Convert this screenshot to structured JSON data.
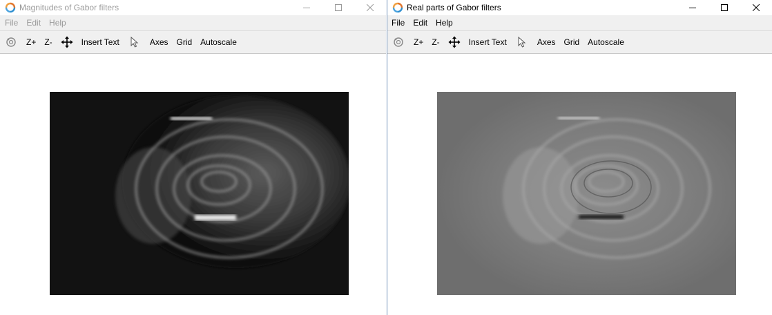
{
  "windows": [
    {
      "title": "Magnitudes of Gabor filters",
      "state": "inactive",
      "menu": [
        "File",
        "Edit",
        "Help"
      ],
      "toolbar": {
        "zoom_in": "Z+",
        "zoom_out": "Z-",
        "insert_text": "Insert Text",
        "axes": "Axes",
        "grid": "Grid",
        "autoscale": "Autoscale"
      }
    },
    {
      "title": "Real parts of Gabor filters",
      "state": "active",
      "menu": [
        "File",
        "Edit",
        "Help"
      ],
      "toolbar": {
        "zoom_in": "Z+",
        "zoom_out": "Z-",
        "insert_text": "Insert Text",
        "axes": "Axes",
        "grid": "Grid",
        "autoscale": "Autoscale"
      }
    }
  ],
  "colors": {
    "menu_bg": "#f0f0f0",
    "inactive_text": "#9a9a9a",
    "active_text": "#000000",
    "window_border": "#6f8fb8"
  },
  "icons": [
    "octave-app-icon",
    "minimize-icon",
    "maximize-icon",
    "close-icon",
    "rotate-icon",
    "pan-icon",
    "select-arrow-icon"
  ]
}
